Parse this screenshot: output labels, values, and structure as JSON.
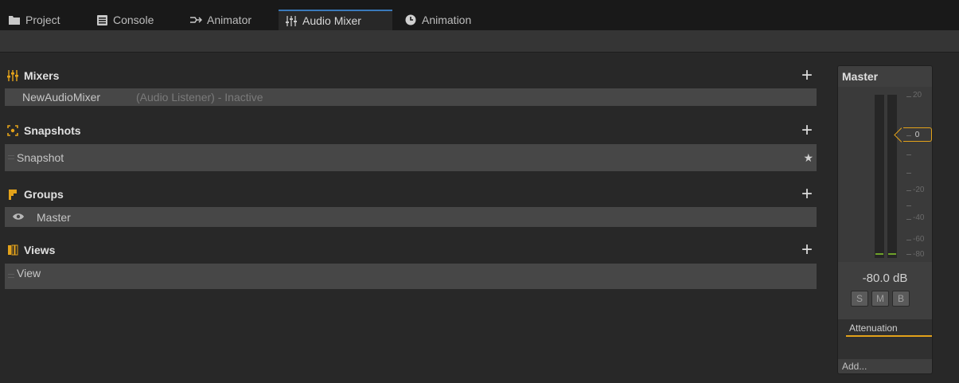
{
  "tabs": [
    {
      "label": "Project",
      "icon": "folder-icon"
    },
    {
      "label": "Console",
      "icon": "console-icon"
    },
    {
      "label": "Animator",
      "icon": "animator-icon"
    },
    {
      "label": "Audio Mixer",
      "icon": "mixer-icon",
      "active": true
    },
    {
      "label": "Animation",
      "icon": "clock-icon"
    }
  ],
  "sections": {
    "mixers": {
      "title": "Mixers",
      "item": "NewAudioMixer",
      "item_status": "(Audio Listener) - Inactive"
    },
    "snapshots": {
      "title": "Snapshots",
      "item": "Snapshot"
    },
    "groups": {
      "title": "Groups",
      "item": "Master"
    },
    "views": {
      "title": "Views",
      "item": "View"
    }
  },
  "strip": {
    "title": "Master",
    "scale": [
      "20",
      "0",
      "-20",
      "-40",
      "-60",
      "-80"
    ],
    "volume_knob": "0",
    "db_value": "-80.0 dB",
    "buttons": [
      "S",
      "M",
      "B"
    ],
    "effect": "Attenuation",
    "add_label": "Add..."
  },
  "colors": {
    "accent": "#e3a21a",
    "active_tab": "#3a79bb",
    "meter_level": "#6ea12a"
  }
}
